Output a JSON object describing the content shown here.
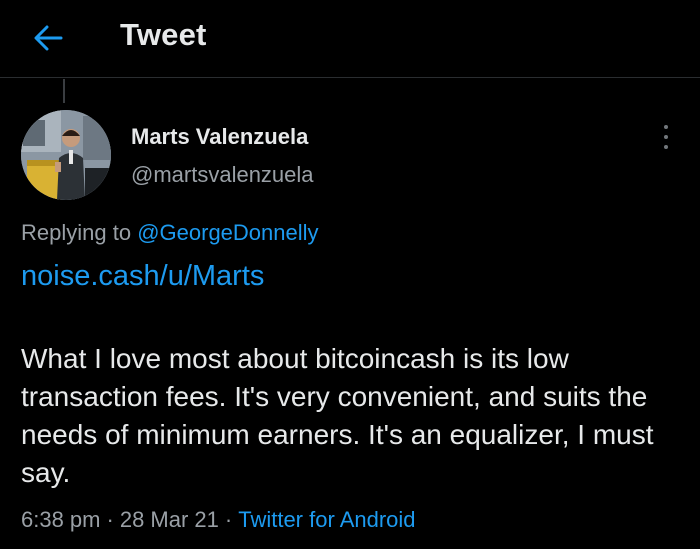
{
  "header": {
    "title": "Tweet",
    "back_icon": "arrow-left-icon"
  },
  "author": {
    "name": "Marts Valenzuela",
    "handle": "@martsvalenzuela",
    "avatar_icon": "user-avatar"
  },
  "more_icon": "vertical-ellipsis-icon",
  "reply": {
    "prefix": "Replying to",
    "mention": "@GeorgeDonnelly"
  },
  "tweet": {
    "link": "noise.cash/u/Marts",
    "text": "What I love most about bitcoincash is its low transaction fees. It's very convenient, and suits the needs of minimum earners. It's an equalizer, I must say."
  },
  "meta": {
    "time": "6:38 pm",
    "separator": "·",
    "date": "28 Mar 21",
    "source": "Twitter for Android"
  },
  "colors": {
    "background": "#000000",
    "text": "#e7e9ea",
    "secondary": "#9aa0a6",
    "accent": "#1d9bf0"
  }
}
